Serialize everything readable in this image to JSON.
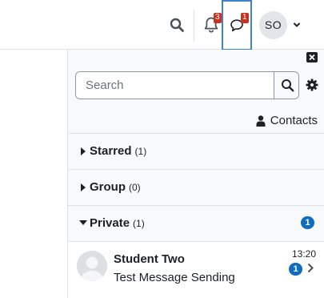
{
  "navbar": {
    "notifications_count": "3",
    "messages_count": "1",
    "user_initials": "SO"
  },
  "drawer": {
    "search": {
      "placeholder": "Search",
      "value": ""
    },
    "contacts_label": "Contacts",
    "sections": [
      {
        "label": "Starred",
        "count": "(1)",
        "expanded": false
      },
      {
        "label": "Group",
        "count": "(0)",
        "expanded": false
      },
      {
        "label": "Private",
        "count": "(1)",
        "expanded": true,
        "unread": "1"
      }
    ],
    "conversation": {
      "name": "Student Two",
      "message": "Test Message Sending",
      "time": "13:20",
      "unread": "1"
    }
  },
  "colors": {
    "accent": "#3d83c6",
    "badge_red": "#ca3120",
    "badge_blue": "#0f6cbf"
  },
  "icons": [
    "search-icon",
    "bell-icon",
    "chat-bubble-icon",
    "caret-down-icon",
    "close-icon",
    "gear-icon",
    "user-icon",
    "triangle-right-icon",
    "triangle-down-icon",
    "chevron-right-icon"
  ]
}
